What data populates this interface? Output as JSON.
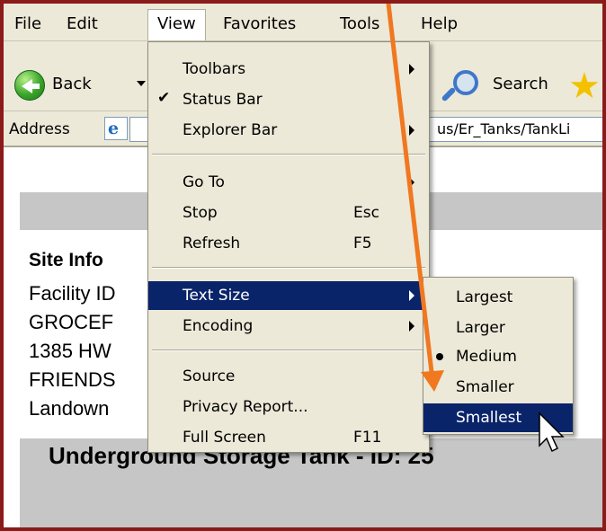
{
  "menubar": {
    "items": [
      {
        "label": "File"
      },
      {
        "label": "Edit"
      },
      {
        "label": "View"
      },
      {
        "label": "Favorites"
      },
      {
        "label": "Tools"
      },
      {
        "label": "Help"
      }
    ]
  },
  "toolbar": {
    "back_label": "Back",
    "search_label": "Search"
  },
  "address": {
    "label": "Address",
    "url_visible": "us/Er_Tanks/TankLi"
  },
  "view_menu": {
    "items": [
      {
        "label": "Toolbars",
        "checked": false,
        "submenu": true
      },
      {
        "label": "Status Bar",
        "checked": true
      },
      {
        "label": "Explorer Bar",
        "submenu": true
      },
      {
        "label": "Go To",
        "submenu": true
      },
      {
        "label": "Stop",
        "shortcut": "Esc"
      },
      {
        "label": "Refresh",
        "shortcut": "F5"
      },
      {
        "label": "Text Size",
        "submenu": true,
        "highlighted": true
      },
      {
        "label": "Encoding",
        "submenu": true
      },
      {
        "label": "Source"
      },
      {
        "label": "Privacy Report..."
      },
      {
        "label": "Full Screen",
        "shortcut": "F11"
      }
    ]
  },
  "text_size_menu": {
    "items": [
      {
        "label": "Largest"
      },
      {
        "label": "Larger"
      },
      {
        "label": "Medium",
        "selected": true
      },
      {
        "label": "Smaller"
      },
      {
        "label": "Smallest",
        "highlighted": true
      }
    ]
  },
  "content": {
    "section_heading": "Site Info",
    "info_lines": [
      "Facility ID",
      "GROCEF",
      "1385 HW",
      "FRIENDS",
      "Landown"
    ],
    "tank_title": "Underground Storage Tank - ID: 25"
  },
  "colors": {
    "frame_border": "#8b1a1a",
    "menu_bg": "#ece9d8",
    "highlight": "#0a246a",
    "arrow": "#f07820"
  },
  "icons": {
    "back": "back-arrow-icon",
    "search": "search-magnifier-icon",
    "favorites": "favorites-star-icon",
    "address": "ie-page-icon",
    "cursor": "mouse-pointer-icon"
  }
}
